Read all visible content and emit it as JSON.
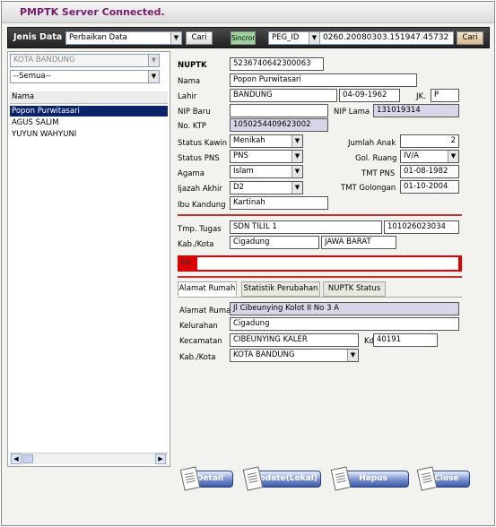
{
  "window": {
    "title": "PMPTK  Server Connected."
  },
  "toolbar": {
    "label": "Jenis Data",
    "jenis_value": "Perbaikan Data",
    "cari1": "Cari",
    "sincron": "Sincron",
    "peg_select": "PEG_ID",
    "peg_value": "0260.20080303.151947.45732",
    "cari2": "Cari"
  },
  "left": {
    "kota_value": "KOTA BANDUNG",
    "semua_value": "--Semua--",
    "list_header": "Nama",
    "items": [
      "Popon Purwitasari",
      "AGUS SALIM",
      "YUYUN WAHYUNI"
    ]
  },
  "form": {
    "nuptk_label": "NUPTK",
    "nuptk": "5236740642300063",
    "nama_label": "Nama",
    "nama": "Popon Purwitasari",
    "lahir_label": "Lahir",
    "lahir_tempat": "BANDUNG",
    "lahir_tgl": "04-09-1962",
    "jk_label": "JK.",
    "jk": "P",
    "nip_baru_label": "NIP Baru",
    "nip_baru": "",
    "nip_lama_label": "NIP Lama",
    "nip_lama": "131019314",
    "ktp_label": "No. KTP",
    "ktp": "1050254409623002",
    "status_kawin_label": "Status Kawin",
    "status_kawin": "Menikah",
    "jumlah_anak_label": "Jumlah Anak",
    "jumlah_anak": "2",
    "status_pns_label": "Status PNS",
    "status_pns": "PNS",
    "gol_ruang_label": "Gol. Ruang",
    "gol_ruang": "IV/A",
    "agama_label": "Agama",
    "agama": "Islam",
    "tmt_pns_label": "TMT PNS",
    "tmt_pns": "01-08-1982",
    "ijazah_label": "Ijazah Akhir",
    "ijazah": "D2",
    "tmt_gol_label": "TMT  Golongan",
    "tmt_gol": "01-10-2004",
    "ibu_label": "Ibu Kandung",
    "ibu": "Kartinah",
    "tmp_tugas_label": "Tmp. Tugas",
    "tmp_tugas": "SDN TILIL 1",
    "tmp_tugas_kode": "101026023034",
    "kabkota_label": "Kab./Kota",
    "kabkota": "Cigadung",
    "provinsi": "JAWA BARAT",
    "ket_label": "Ket"
  },
  "tabs": [
    "Alamat Rumah",
    "Statistik Perubahan",
    "NUPTK Status"
  ],
  "alamat": {
    "alamat_label": "Alamat Rumah",
    "alamat": "Jl Cibeunying Kolot II No 3 A",
    "kelurahan_label": "Kelurahan",
    "kelurahan": "Cigadung",
    "kecamatan_label": "Kecamatan",
    "kecamatan": "CIBEUNYING KALER",
    "kodepos_label": "Kd",
    "kodepos": "40191",
    "kab_label": "Kab./Kota",
    "kab": "KOTA BANDUNG"
  },
  "buttons": {
    "detail": "Detail",
    "update": "Update(Lokal)",
    "hapus": "Hapus",
    "close": "Close"
  },
  "colors": {
    "title": "#7a1c6d",
    "accent_red": "#e00000",
    "selection": "#0a246a",
    "readonly": "#d6d6e8"
  },
  "icons": {
    "dropdown": "chevron-down-icon",
    "scroll_left": "arrow-left-icon",
    "scroll_right": "arrow-right-icon",
    "button": "document-icon"
  }
}
